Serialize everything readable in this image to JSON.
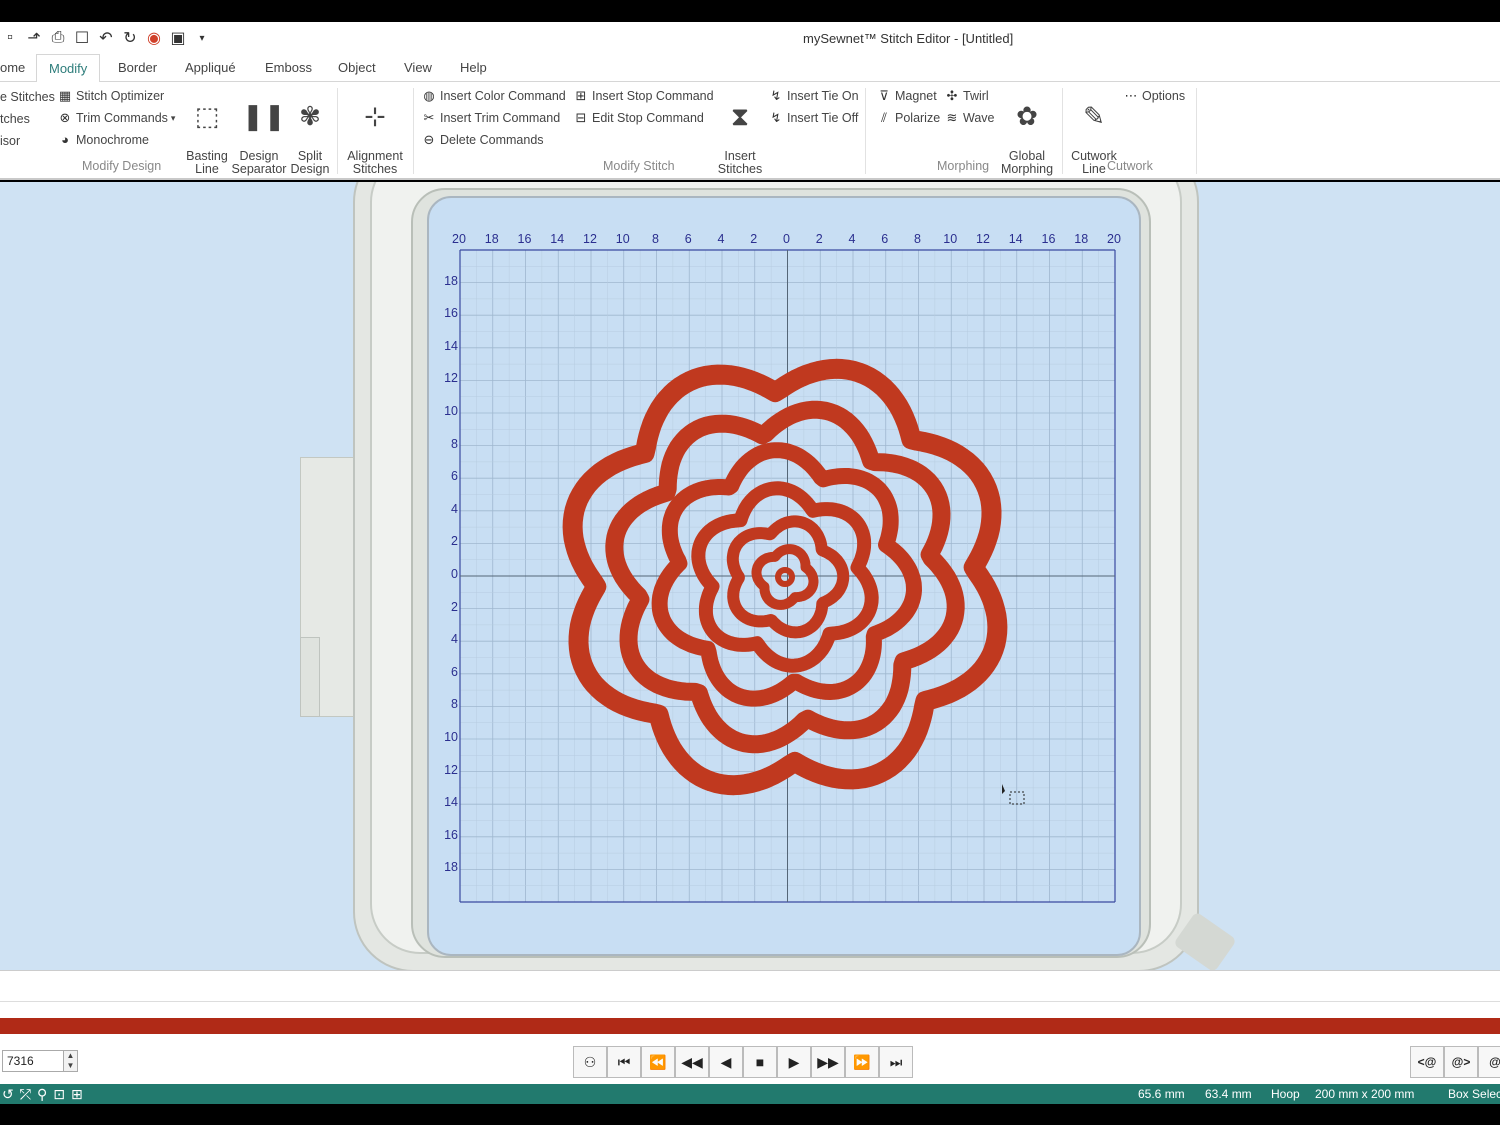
{
  "app": {
    "title": "mySewnet™ Stitch Editor - [Untitled]"
  },
  "quick_access": [
    "save-icon",
    "print-icon",
    "select-icon",
    "undo-icon",
    "redo-icon",
    "color-wheel-icon",
    "play-icon",
    "dropdown-icon"
  ],
  "tabs": [
    {
      "label": "ome"
    },
    {
      "label": "Modify",
      "active": true
    },
    {
      "label": "Border"
    },
    {
      "label": "Appliqué"
    },
    {
      "label": "Emboss"
    },
    {
      "label": "Object"
    },
    {
      "label": "View"
    },
    {
      "label": "Help"
    }
  ],
  "ribbon": {
    "modify_design": {
      "group": "Modify Design",
      "small": [
        "e Stitches",
        "tches",
        "isor",
        "Stitch Optimizer",
        "Trim Commands",
        "Monochrome"
      ],
      "big": [
        "Basting\nLine",
        "Design\nSeparator",
        "Split\nDesign"
      ]
    },
    "alignment": {
      "big": "Alignment\nStitches"
    },
    "modify_stitch": {
      "group": "Modify Stitch",
      "small": [
        "Insert Color Command",
        "Insert Trim Command",
        "Delete Commands",
        "Insert Stop Command",
        "Edit Stop Command",
        "Insert Tie On",
        "Insert Tie Off"
      ],
      "big": "Insert\nStitches"
    },
    "morphing": {
      "group": "Morphing",
      "small": [
        "Magnet",
        "Twirl",
        "Polarize",
        "Wave"
      ],
      "big": "Global\nMorphing"
    },
    "cutwork": {
      "group": "Cutwork",
      "big": "Cutwork\nLine",
      "small": "Options"
    }
  },
  "grid": {
    "x_labels": [
      "20",
      "18",
      "16",
      "14",
      "12",
      "10",
      "8",
      "6",
      "4",
      "2",
      "0",
      "2",
      "4",
      "6",
      "8",
      "10",
      "12",
      "14",
      "16",
      "18",
      "20"
    ],
    "y_labels": [
      "18",
      "16",
      "14",
      "12",
      "10",
      "8",
      "6",
      "4",
      "2",
      "0",
      "2",
      "4",
      "6",
      "8",
      "10",
      "12",
      "14",
      "16",
      "18"
    ]
  },
  "design": {
    "color": "#c0391f"
  },
  "controls": {
    "stitch_count": "7316",
    "player": [
      "stitch-icon",
      "first-icon",
      "fast-back-icon",
      "back-icon",
      "step-back-icon",
      "stop-icon",
      "step-forward-icon",
      "forward-icon",
      "fast-forward-icon",
      "last-icon"
    ],
    "right": [
      "<@",
      "@>",
      "@"
    ]
  },
  "status": {
    "width": "65.6 mm",
    "height": "63.4 mm",
    "hoop_label": "Hoop",
    "hoop_size": "200 mm x 200 mm",
    "mode": "Box Selec"
  }
}
